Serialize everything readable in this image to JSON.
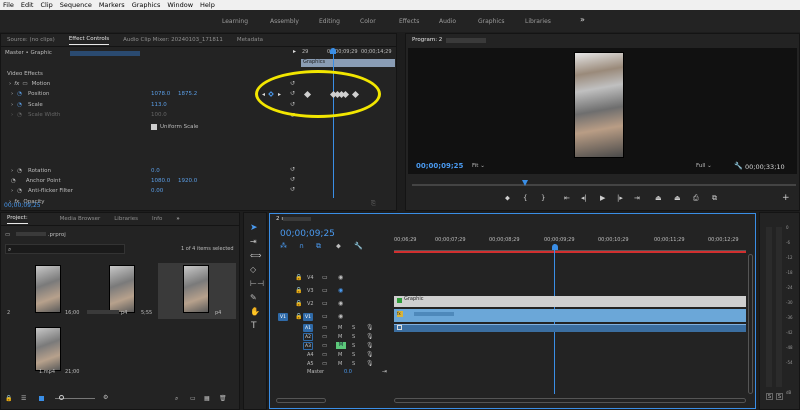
{
  "menu": [
    "File",
    "Edit",
    "Clip",
    "Sequence",
    "Markers",
    "Graphics",
    "Window",
    "Help"
  ],
  "workspaces": [
    "Learning",
    "Assembly",
    "Editing",
    "Color",
    "Effects",
    "Audio",
    "Graphics",
    "Libraries"
  ],
  "workspaces_more": "»",
  "source_panel": {
    "tabs": [
      "Source: (no clips)",
      "Effect Controls",
      "Audio Clip Mixer: 20240103_171811",
      "Metadata"
    ],
    "master_label": "Master • Graphic",
    "mini_timecode_left": "29",
    "mini_timecode_mid": "00;00;09;29",
    "mini_timecode_right": "00;00;14;29",
    "graphic_bar": "Graphics",
    "section_video_effects": "Video Effects",
    "motion": "Motion",
    "position_label": "Position",
    "position_x": "1078.0",
    "position_y": "1875.2",
    "scale_label": "Scale",
    "scale_value": "113.0",
    "scale_width_label": "Scale Width",
    "scale_width_value": "100.0",
    "uniform_scale": "Uniform Scale",
    "rotation_label": "Rotation",
    "rotation_value": "0.0",
    "anchor_label": "Anchor Point",
    "anchor_x": "1080.0",
    "anchor_y": "1920.0",
    "antiflicker_label": "Anti-flicker Filter",
    "antiflicker_value": "0.00",
    "opacity_label": "Opacity",
    "mask_label": "Mask (1)",
    "timecode": "00;00;09;25"
  },
  "program": {
    "title": "Program: 2",
    "timecode": "00;00;09;25",
    "fit": "Fit",
    "quality": "Full",
    "duration": "00;00;33;10"
  },
  "project": {
    "tabs": [
      "Project:",
      "Media Browser",
      "Libraries",
      "Info"
    ],
    "project_name": ".prproj",
    "items_selected": "1 of 4 items selected",
    "items": [
      {
        "name": "2",
        "duration": "16;00"
      },
      {
        "name": "p4",
        "duration": "5;55"
      },
      {
        "name": "p4",
        "duration": ""
      },
      {
        "name": "1.mp4",
        "duration": "21;00"
      }
    ]
  },
  "timeline": {
    "title": "2",
    "timecode": "00;00;09;25",
    "ruler": [
      "00;06;29",
      "00;00;07;29",
      "00;00;08;29",
      "00;00;09;29",
      "00;00;10;29",
      "00;00;11;29",
      "00;00;12;29"
    ],
    "tracks": [
      "V4",
      "V3",
      "V2",
      "V1",
      "A1",
      "A2",
      "A3",
      "A4",
      "A5"
    ],
    "master": "Master",
    "master_value": "0.0",
    "clip_graphic": "Graphic",
    "clip_fx": "fx"
  },
  "audio_meter_labels": [
    "0",
    "-6",
    "-12",
    "-18",
    "-24",
    "-30",
    "-36",
    "-42",
    "-48",
    "-54",
    "dB"
  ],
  "audio_solo": [
    "S",
    "S"
  ],
  "colors": {
    "accent_blue": "#2d8ceb",
    "annotation_yellow": "#f2e600",
    "playhead": "#3a8ee6",
    "clip_gray": "#cfcfcf",
    "clip_blue": "#6ba7d8"
  }
}
